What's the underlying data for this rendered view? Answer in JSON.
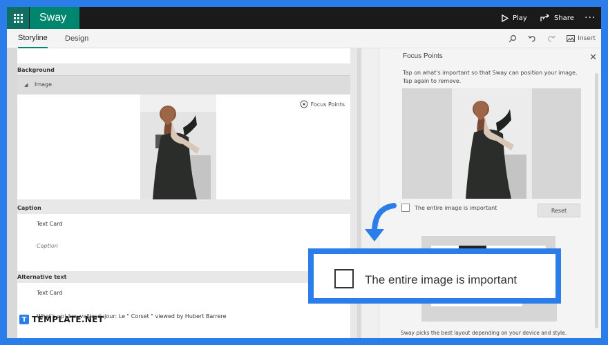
{
  "app": {
    "title": "Sway"
  },
  "topbar": {
    "play_label": "Play",
    "share_label": "Share",
    "more_label": "···"
  },
  "tabs": [
    {
      "label": "Storyline"
    },
    {
      "label": "Design"
    }
  ],
  "toolbar": {
    "insert_label": "Insert"
  },
  "editor": {
    "background_heading": "Background",
    "image_heading": "Image",
    "focus_points_label": "Focus Points",
    "caption_heading": "Caption",
    "caption_card_type": "Text Card",
    "caption_placeholder": "Caption",
    "alt_text_heading": "Alternative text",
    "alt_card_type": "Text Card",
    "alt_text_value": "What's up! Ixouvaillesdujour: Le \" Corset \" viewed by Hubert Barrere"
  },
  "focus_panel": {
    "title": "Focus Points",
    "instructions": "Tap on what's important so that Sway can position your image. Tap again to remove.",
    "checkbox_label": "The entire image is important",
    "reset_label": "Reset",
    "footer_text": "Sway picks the best layout depending on your device and style."
  },
  "callout": {
    "checkbox_label": "The entire image is important"
  },
  "watermark": {
    "mark": "T",
    "name": "TEMPLATE.NET"
  },
  "colors": {
    "accent": "#00856f",
    "topbar": "#1a1a1a",
    "frame": "#2b7de9"
  }
}
